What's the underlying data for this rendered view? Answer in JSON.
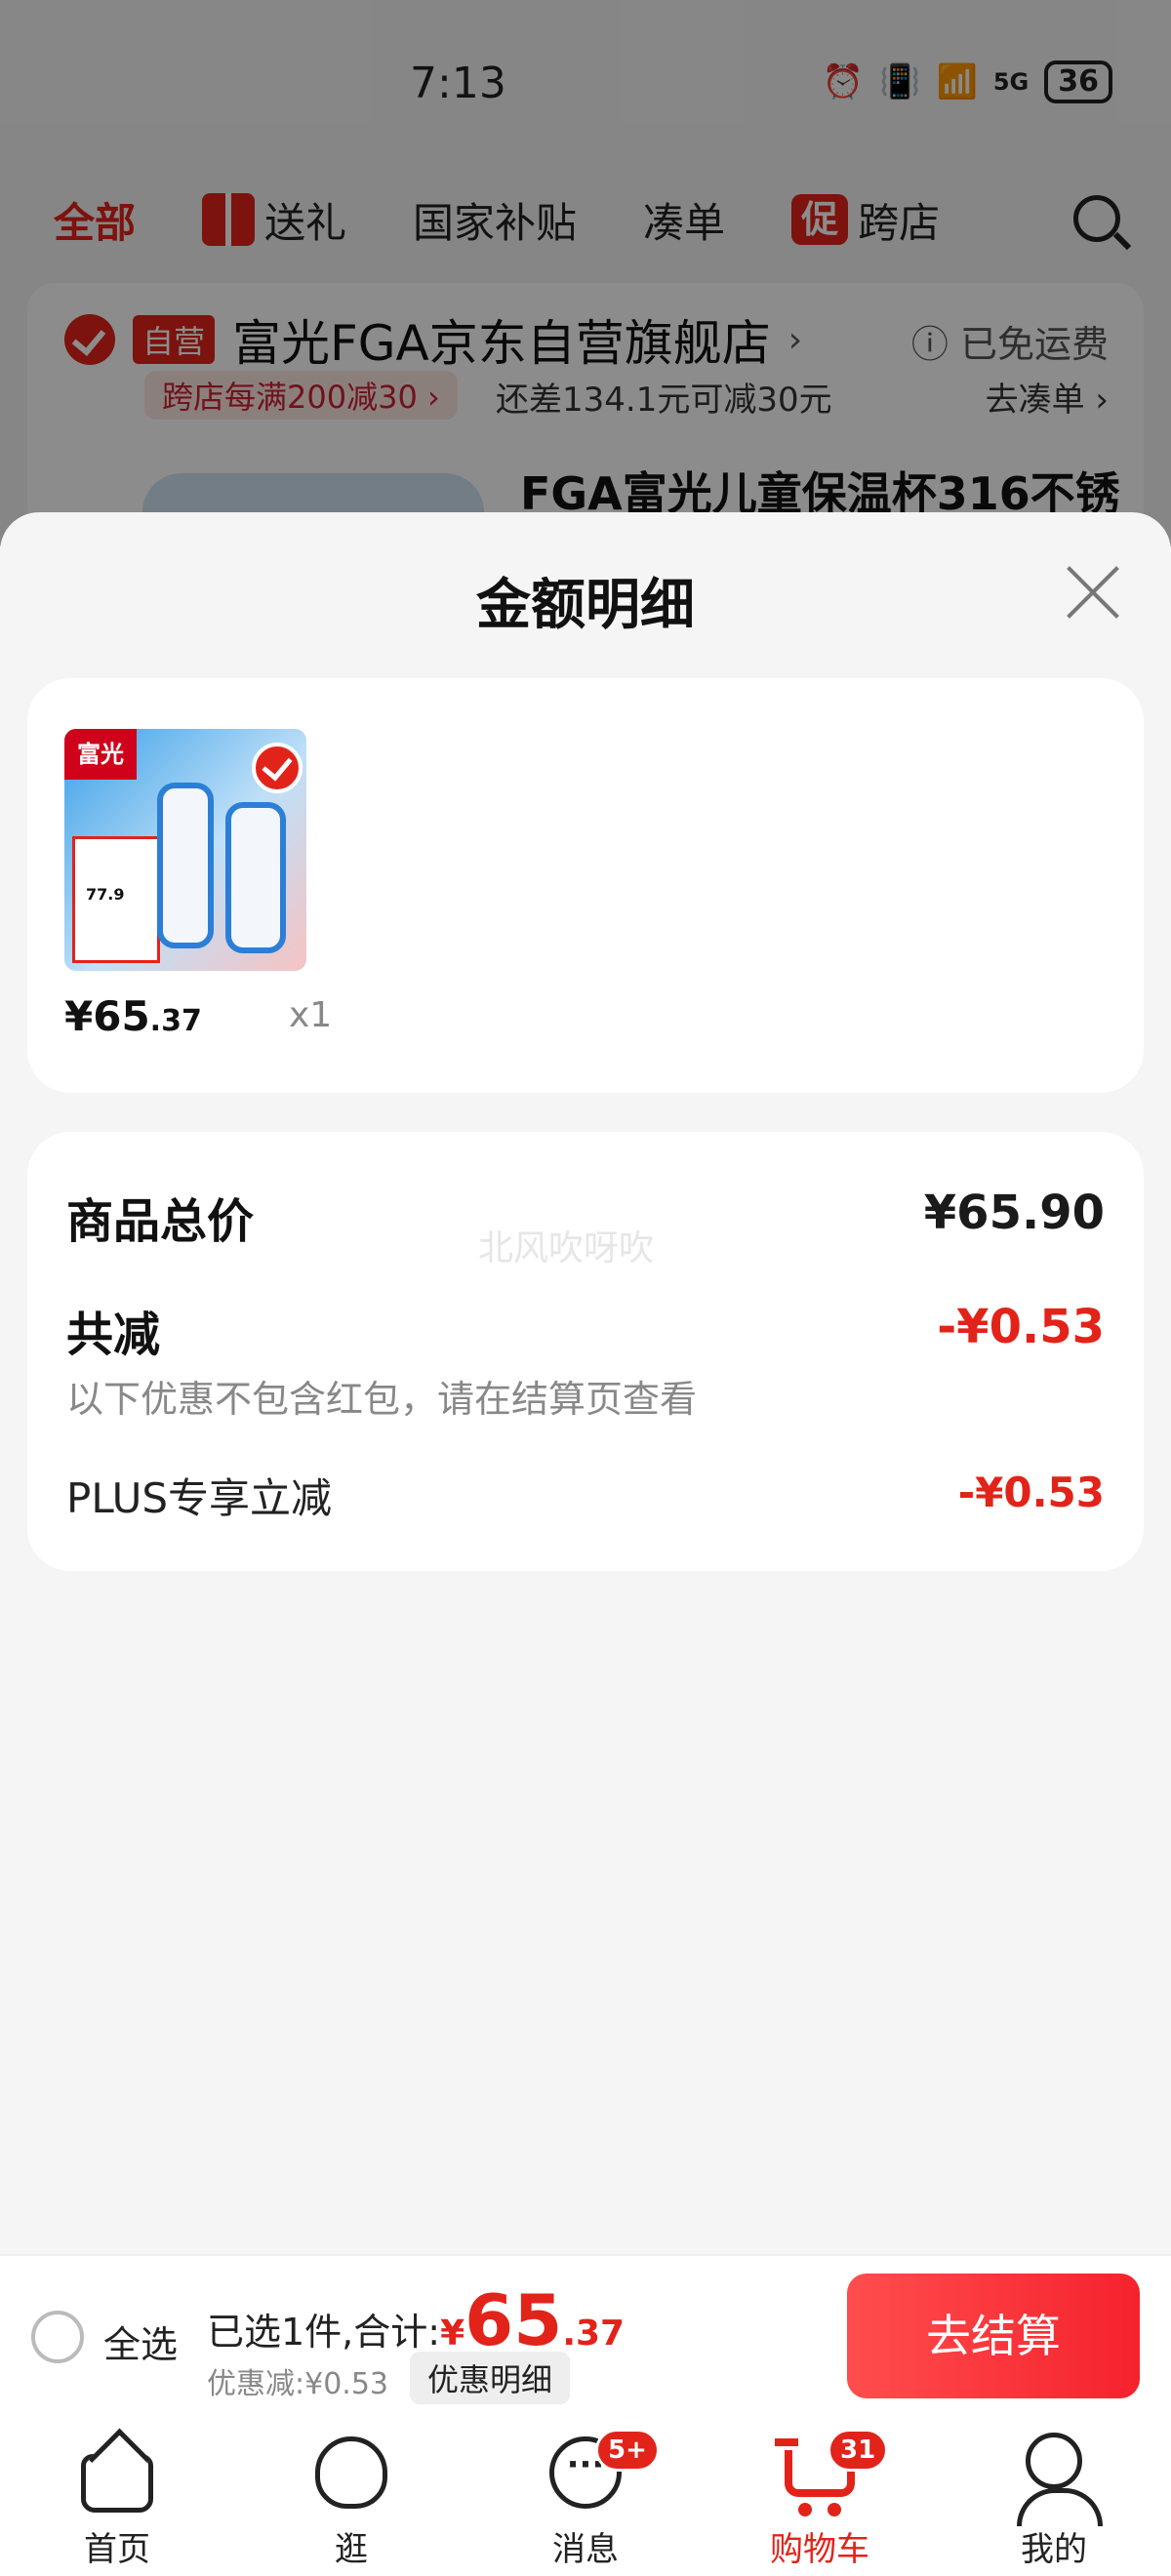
{
  "status_bar": {
    "time": "7:13",
    "network": "5G",
    "battery": "36"
  },
  "category_tabs": [
    {
      "label": "全部",
      "active": true
    },
    {
      "label": "送礼",
      "icon": "gift-icon"
    },
    {
      "label": "国家补贴"
    },
    {
      "label": "凑单"
    },
    {
      "label": "跨店",
      "tag": "促"
    }
  ],
  "store": {
    "self_tag": "自营",
    "name": "富光FGA京东自营旗舰店",
    "chevron": "›",
    "shipping_note": "已免运费",
    "promo": "跨店每满200减30 ›",
    "promo_progress": "还差134.1元可减30元",
    "promo_action": "去凑单 ›",
    "product_title": "FGA富光儿童保温杯316不锈"
  },
  "sheet": {
    "title": "金额明细",
    "item": {
      "brand": "富光",
      "thumb_price": "77.9",
      "price_int": "¥65",
      "price_dec": ".37",
      "qty": "x1"
    },
    "summary": {
      "total_label": "商品总价",
      "total_value": "¥65.90",
      "discount_label": "共减",
      "discount_value": "-¥0.53",
      "discount_note": "以下优惠不包含红包，请在结算页查看",
      "plus_label": "PLUS专享立减",
      "plus_value": "-¥0.53",
      "watermark": "北风吹呀吹"
    }
  },
  "checkout": {
    "select_all": "全选",
    "selected_text": "已选1件,合计:",
    "currency": "¥",
    "total_int": "65",
    "total_dec": ".37",
    "discount_text": "优惠减:¥0.53",
    "detail_label": "优惠明细",
    "button": "去结算"
  },
  "tabbar": [
    {
      "label": "首页",
      "icon": "home-icon"
    },
    {
      "label": "逛",
      "icon": "explore-icon"
    },
    {
      "label": "消息",
      "icon": "message-icon",
      "badge": "5+"
    },
    {
      "label": "购物车",
      "icon": "cart-icon",
      "badge": "31",
      "active": true
    },
    {
      "label": "我的",
      "icon": "profile-icon"
    }
  ],
  "colors": {
    "accent": "#e2231a",
    "background": "#f5f5f5"
  }
}
